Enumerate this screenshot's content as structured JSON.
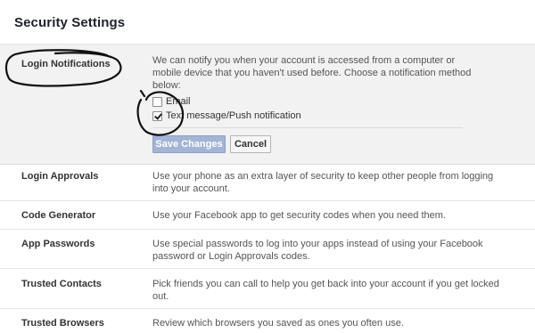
{
  "page": {
    "title": "Security Settings"
  },
  "login_notifications": {
    "label": "Login Notifications",
    "description": "We can notify you when your account is accessed from a computer or mobile device that you haven't used before. Choose a notification method below:",
    "options": [
      {
        "label": "Email",
        "checked": false
      },
      {
        "label": "Text message/Push notification",
        "checked": true
      }
    ],
    "save_label": "Save Changes",
    "cancel_label": "Cancel"
  },
  "rows": [
    {
      "label": "Login Approvals",
      "description": "Use your phone as an extra layer of security to keep other people from logging into your account."
    },
    {
      "label": "Code Generator",
      "description": "Use your Facebook app to get security codes when you need them."
    },
    {
      "label": "App Passwords",
      "description": "Use special passwords to log into your apps instead of using your Facebook password or Login Approvals codes."
    },
    {
      "label": "Trusted Contacts",
      "description": "Pick friends you can call to help you get back into your account if you get locked out."
    },
    {
      "label": "Trusted Browsers",
      "description": "Review which browsers you saved as ones you often use."
    }
  ]
}
